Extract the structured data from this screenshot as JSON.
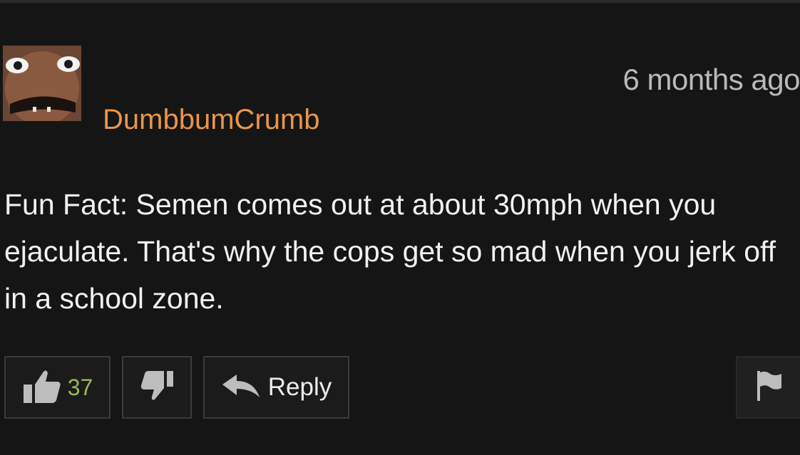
{
  "comment": {
    "author": "DumbbumCrumb",
    "timestamp": "6 months ago",
    "body": "Fun Fact: Semen comes out at about 30mph when you ejaculate. That's why the cops get so mad when you jerk off in a school zone."
  },
  "actions": {
    "like_count": "37",
    "reply_label": "Reply"
  },
  "icons": {
    "like": "thumbs-up-icon",
    "dislike": "thumbs-down-icon",
    "reply": "reply-arrow-icon",
    "flag": "flag-icon"
  },
  "colors": {
    "background": "#151515",
    "username": "#e9954a",
    "like_count": "#9ab85a",
    "text": "#f1f1f1",
    "timestamp": "#b9b9b9"
  }
}
